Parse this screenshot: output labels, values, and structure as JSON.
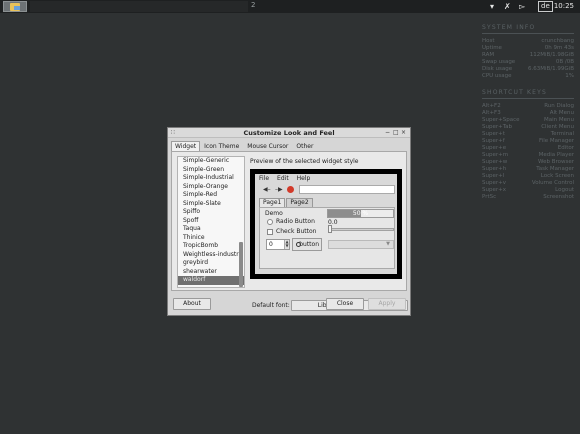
{
  "panel": {
    "workspace": "2",
    "keyboard_layout": "de",
    "clock": "10:25"
  },
  "conky": {
    "system_info": {
      "title": "SYSTEM INFO",
      "rows": [
        {
          "label": "Host",
          "value": "crunchbang"
        },
        {
          "label": "Uptime",
          "value": "0h 9m 43s"
        },
        {
          "label": "RAM",
          "value": "112MiB/1.98GiB"
        },
        {
          "label": "Swap usage",
          "value": "0B /0B"
        },
        {
          "label": "Disk usage",
          "value": "6.63MiB/1.99GiB"
        },
        {
          "label": "CPU usage",
          "value": "1%"
        }
      ]
    },
    "shortcut_keys": {
      "title": "SHORTCUT KEYS",
      "rows": [
        {
          "label": "Alt+F2",
          "value": "Run Dialog"
        },
        {
          "label": "Alt+F3",
          "value": "Alt Menu"
        },
        {
          "label": "Super+Space",
          "value": "Main Menu"
        },
        {
          "label": "Super+Tab",
          "value": "Client Menu"
        },
        {
          "label": "Super+t",
          "value": "Terminal"
        },
        {
          "label": "Super+f",
          "value": "File Manager"
        },
        {
          "label": "Super+e",
          "value": "Editor"
        },
        {
          "label": "Super+m",
          "value": "Media Player"
        },
        {
          "label": "Super+w",
          "value": "Web Browser"
        },
        {
          "label": "Super+h",
          "value": "Task Manager"
        },
        {
          "label": "Super+l",
          "value": "Lock Screen"
        },
        {
          "label": "Super+v",
          "value": "Volume Control"
        },
        {
          "label": "Super+x",
          "value": "Logout"
        },
        {
          "label": "PrtSc",
          "value": "Screenshot"
        }
      ]
    }
  },
  "dialog": {
    "title": "Customize Look and Feel",
    "tabs": [
      "Widget",
      "Icon Theme",
      "Mouse Cursor",
      "Other"
    ],
    "themes": [
      "Simple-Generic",
      "Simple-Green",
      "Simple-Industrial",
      "Simple-Orange",
      "Simple-Red",
      "Simple-Slate",
      "Spiffo",
      "Spoff",
      "Taqua",
      "Thinice",
      "TropicBomb",
      "Weightless-industry",
      "greybird",
      "shearwater",
      "waldorf"
    ],
    "selected_theme": "waldorf",
    "preview_label": "Preview of the selected widget style",
    "preview": {
      "menus": [
        "File",
        "Edit",
        "Help"
      ],
      "tabs": [
        "Page1",
        "Page2"
      ],
      "frame_label": "Demo",
      "radio_label": "Radio Button",
      "check_label": "Check Button",
      "spin_value": "0",
      "button_label": "button",
      "progress_text": "50 %",
      "progress": 0.5,
      "scale_value": "0.0"
    },
    "default_font_label": "Default font:",
    "font_name": "Liberation Sans",
    "font_size": "10",
    "about_label": "About",
    "close_label": "Close",
    "apply_label": "Apply"
  }
}
